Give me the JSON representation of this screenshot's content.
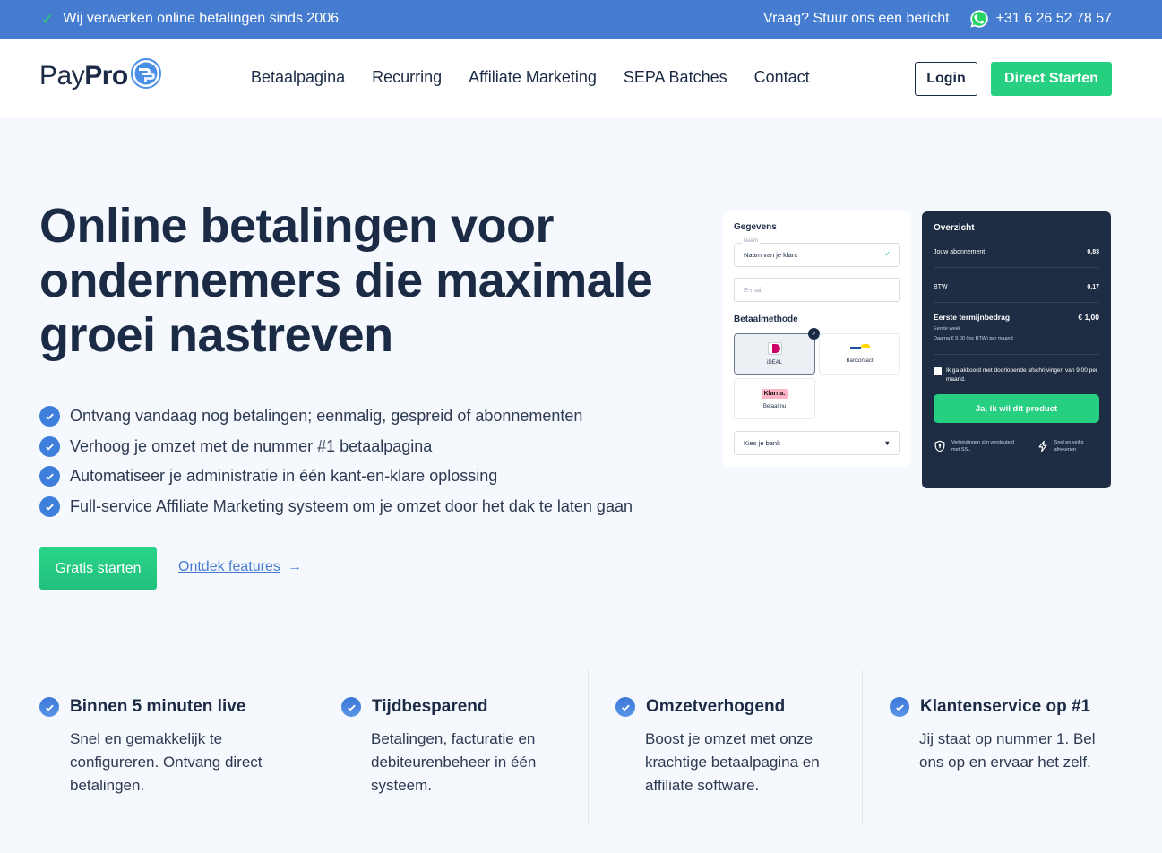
{
  "topbar": {
    "tagline": "Wij verwerken online betalingen sinds 2006",
    "question": "Vraag? Stuur ons een bericht",
    "phone": "+31 6 26 52 78 57",
    "icons": {
      "tagline": "check-icon",
      "phone": "whatsapp-icon"
    }
  },
  "nav": {
    "logo_light": "Pay",
    "logo_bold": "Pro",
    "menu": [
      "Betaalpagina",
      "Recurring",
      "Affiliate Marketing",
      "SEPA Batches",
      "Contact"
    ],
    "login": "Login",
    "start": "Direct Starten"
  },
  "hero": {
    "title": "Online betalingen voor ondernemers die maximale groei nastreven",
    "bullets": [
      "Ontvang vandaag nog betalingen; eenmalig, gespreid of abonnementen",
      "Verhoog je omzet met de nummer #1 betaalpagina",
      "Automatiseer je administratie in één kant-en-klare oplossing",
      "Full-service Affiliate Marketing systeem om je omzet door het dak te laten gaan"
    ],
    "cta_primary": "Gratis starten",
    "cta_secondary": "Ontdek features",
    "cta_secondary_icon": "→"
  },
  "form_card": {
    "title": "Gegevens",
    "name_label": "Naam",
    "name_value": "Naam van je klant",
    "email_placeholder": "E-mail",
    "method_title": "Betaalmethode",
    "methods": [
      {
        "label": "iDEAL",
        "selected": true
      },
      {
        "label": "Bancontact",
        "selected": false
      },
      {
        "label": "Betaal nu",
        "logo": "Klarna.",
        "selected": false
      }
    ],
    "bank_select": "Kies je bank",
    "bank_select_icon": "▼"
  },
  "overview_card": {
    "title": "Overzicht",
    "rows": [
      {
        "label": "Jouw abonnement",
        "value": "0,83"
      },
      {
        "label": "BTW",
        "value": "0,17"
      }
    ],
    "total_label": "Eerste termijnbedrag",
    "total_value": "€ 1,00",
    "total_sub1": "Eerste week",
    "total_sub2": "Daarna € 9,00 (inc BTW) per maand",
    "agree": "Ik ga akkoord met doorlopende afschrijvingen van 9,00 per maand.",
    "cta": "Ja, ik wil dit product",
    "trust": [
      {
        "icon": "shield-icon",
        "text": "Verbindingen zijn versleuteld met SSL"
      },
      {
        "icon": "lightning-icon",
        "text": "Snel en veilig afrekenen"
      }
    ]
  },
  "features": [
    {
      "title": "Binnen 5 minuten live",
      "text": "Snel en gemakkelijk te configureren. Ontvang direct betalingen."
    },
    {
      "title": "Tijdbesparend",
      "text": "Betalingen, facturatie en debiteurenbeheer in één systeem."
    },
    {
      "title": "Omzetverhogend",
      "text": "Boost je omzet met onze krachtige betaalpagina en affiliate software."
    },
    {
      "title": "Klantenservice op #1",
      "text": "Jij staat op nummer 1. Bel ons op en ervaar het zelf."
    }
  ],
  "colors": {
    "topbar": "#457ccf",
    "brand_green": "#27d081",
    "navy": "#1c2b45",
    "check_blue": "#3f7fdc",
    "background": "#f5f8fc"
  }
}
